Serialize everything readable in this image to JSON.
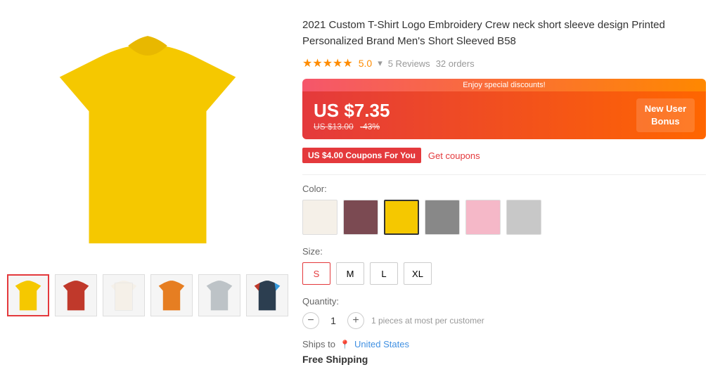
{
  "product": {
    "title": "2021 Custom T-Shirt Logo Embroidery Crew neck short sleeve design Printed Personalized Brand Men's Short Sleeved B58",
    "rating": "5.0",
    "reviews": "5 Reviews",
    "orders": "32 orders",
    "discount_banner": "Enjoy special discounts!",
    "price_current": "US $7.35",
    "price_original": "US $13.00",
    "discount_pct": "-43%",
    "new_user_label1": "New User",
    "new_user_label2": "Bonus",
    "coupon_text": "US $4.00 Coupons For You",
    "get_coupons_label": "Get coupons",
    "color_label": "Color:",
    "colors": [
      {
        "hex": "#f5f0e8",
        "selected": false
      },
      {
        "hex": "#7b4a52",
        "selected": false
      },
      {
        "hex": "#f5c800",
        "selected": true
      },
      {
        "hex": "#888888",
        "selected": false
      },
      {
        "hex": "#f5b8c8",
        "selected": false
      },
      {
        "hex": "#c8c8c8",
        "selected": false
      }
    ],
    "size_label": "Size:",
    "sizes": [
      "S",
      "M",
      "L",
      "XL"
    ],
    "selected_size": "S",
    "quantity_label": "Quantity:",
    "quantity": "1",
    "qty_note": "1 pieces at most per customer",
    "ships_label": "Ships to",
    "ships_to": "United States",
    "free_shipping": "Free Shipping",
    "thumbnails": [
      {
        "color": "#f5c800",
        "active": true
      },
      {
        "color": "#c0392b",
        "active": false
      },
      {
        "color": "#f5f0e8",
        "active": false
      },
      {
        "color": "#e67e22",
        "active": false
      },
      {
        "color": "#bdc3c7",
        "active": false
      },
      {
        "color": "#multi",
        "active": false
      }
    ]
  }
}
